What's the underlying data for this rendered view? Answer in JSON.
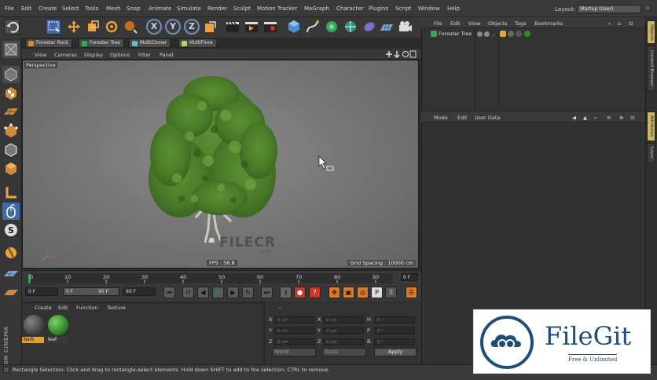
{
  "menubar": {
    "items": [
      "File",
      "Edit",
      "Create",
      "Select",
      "Tools",
      "Mesh",
      "Snap",
      "Animate",
      "Simulate",
      "Render",
      "Sculpt",
      "Motion Tracker",
      "MoGraph",
      "Character",
      "Plugins",
      "Script",
      "Window",
      "Help"
    ],
    "layout_label": "Layout:",
    "layout_value": "Startup (User)"
  },
  "toolbar": {
    "axis_x": "X",
    "axis_y": "Y",
    "axis_z": "Z"
  },
  "scene_tabs": [
    "Forester Rock",
    "Forester Tree",
    "MultiCloner",
    "MultiFlora"
  ],
  "viewport": {
    "menu": [
      "View",
      "Cameras",
      "Display",
      "Options",
      "Filter",
      "Panel"
    ],
    "camera_label": "Perspective",
    "fps": "FPS : 58.8",
    "grid_spacing": "Grid Spacing : 10000 cm",
    "watermark": "FILECR",
    "watermark_sub": ".com"
  },
  "timeline": {
    "ticks": [
      "0",
      "10",
      "20",
      "30",
      "40",
      "50",
      "60",
      "70",
      "80",
      "90"
    ],
    "current_frame": "0 F"
  },
  "transport": {
    "start_frame": "0 F",
    "preview_start": "0 F",
    "preview_end": "90 F",
    "end_frame": "90 F"
  },
  "material_manager": {
    "menu": [
      "Create",
      "Edit",
      "Function",
      "Texture"
    ],
    "materials": [
      {
        "name": "bark"
      },
      {
        "name": "leaf"
      }
    ]
  },
  "coordinates": {
    "header": "--",
    "rows": [
      {
        "a_label": "X",
        "a_val": "0 cm",
        "b_label": "X",
        "b_val": "0 cm",
        "c_label": "H",
        "c_val": "0 °"
      },
      {
        "a_label": "Y",
        "a_val": "0 cm",
        "b_label": "Y",
        "b_val": "0 cm",
        "c_label": "P",
        "c_val": "0 °"
      },
      {
        "a_label": "Z",
        "a_val": "0 cm",
        "b_label": "Z",
        "b_val": "0 cm",
        "c_label": "B",
        "c_val": "0 °"
      }
    ],
    "mode_world": "World",
    "mode_scale": "Scale",
    "apply": "Apply"
  },
  "object_manager": {
    "menu": [
      "File",
      "Edit",
      "View",
      "Objects",
      "Tags",
      "Bookmarks"
    ],
    "object_name": "Forester Tree"
  },
  "attribute_manager": {
    "menu": [
      "Mode",
      "Edit",
      "User Data"
    ]
  },
  "right_tabs": [
    "Objects",
    "Content Browser",
    "Attributes",
    "Layer"
  ],
  "status": "Rectangle Selection: Click and drag to rectangle-select elements. Hold down SHIFT to add to the selection, CTRL to remove.",
  "branding": {
    "maxon": "MAXON CINEMA 4D",
    "filegit_title": "FileGit",
    "filegit_sub": "Free & Unlimited"
  },
  "colors": {
    "accent_orange": "#e07a1c",
    "filegit_blue": "#1d4e78",
    "tree_green": "#4e7f2a",
    "active_tab": "#c9b46a"
  }
}
